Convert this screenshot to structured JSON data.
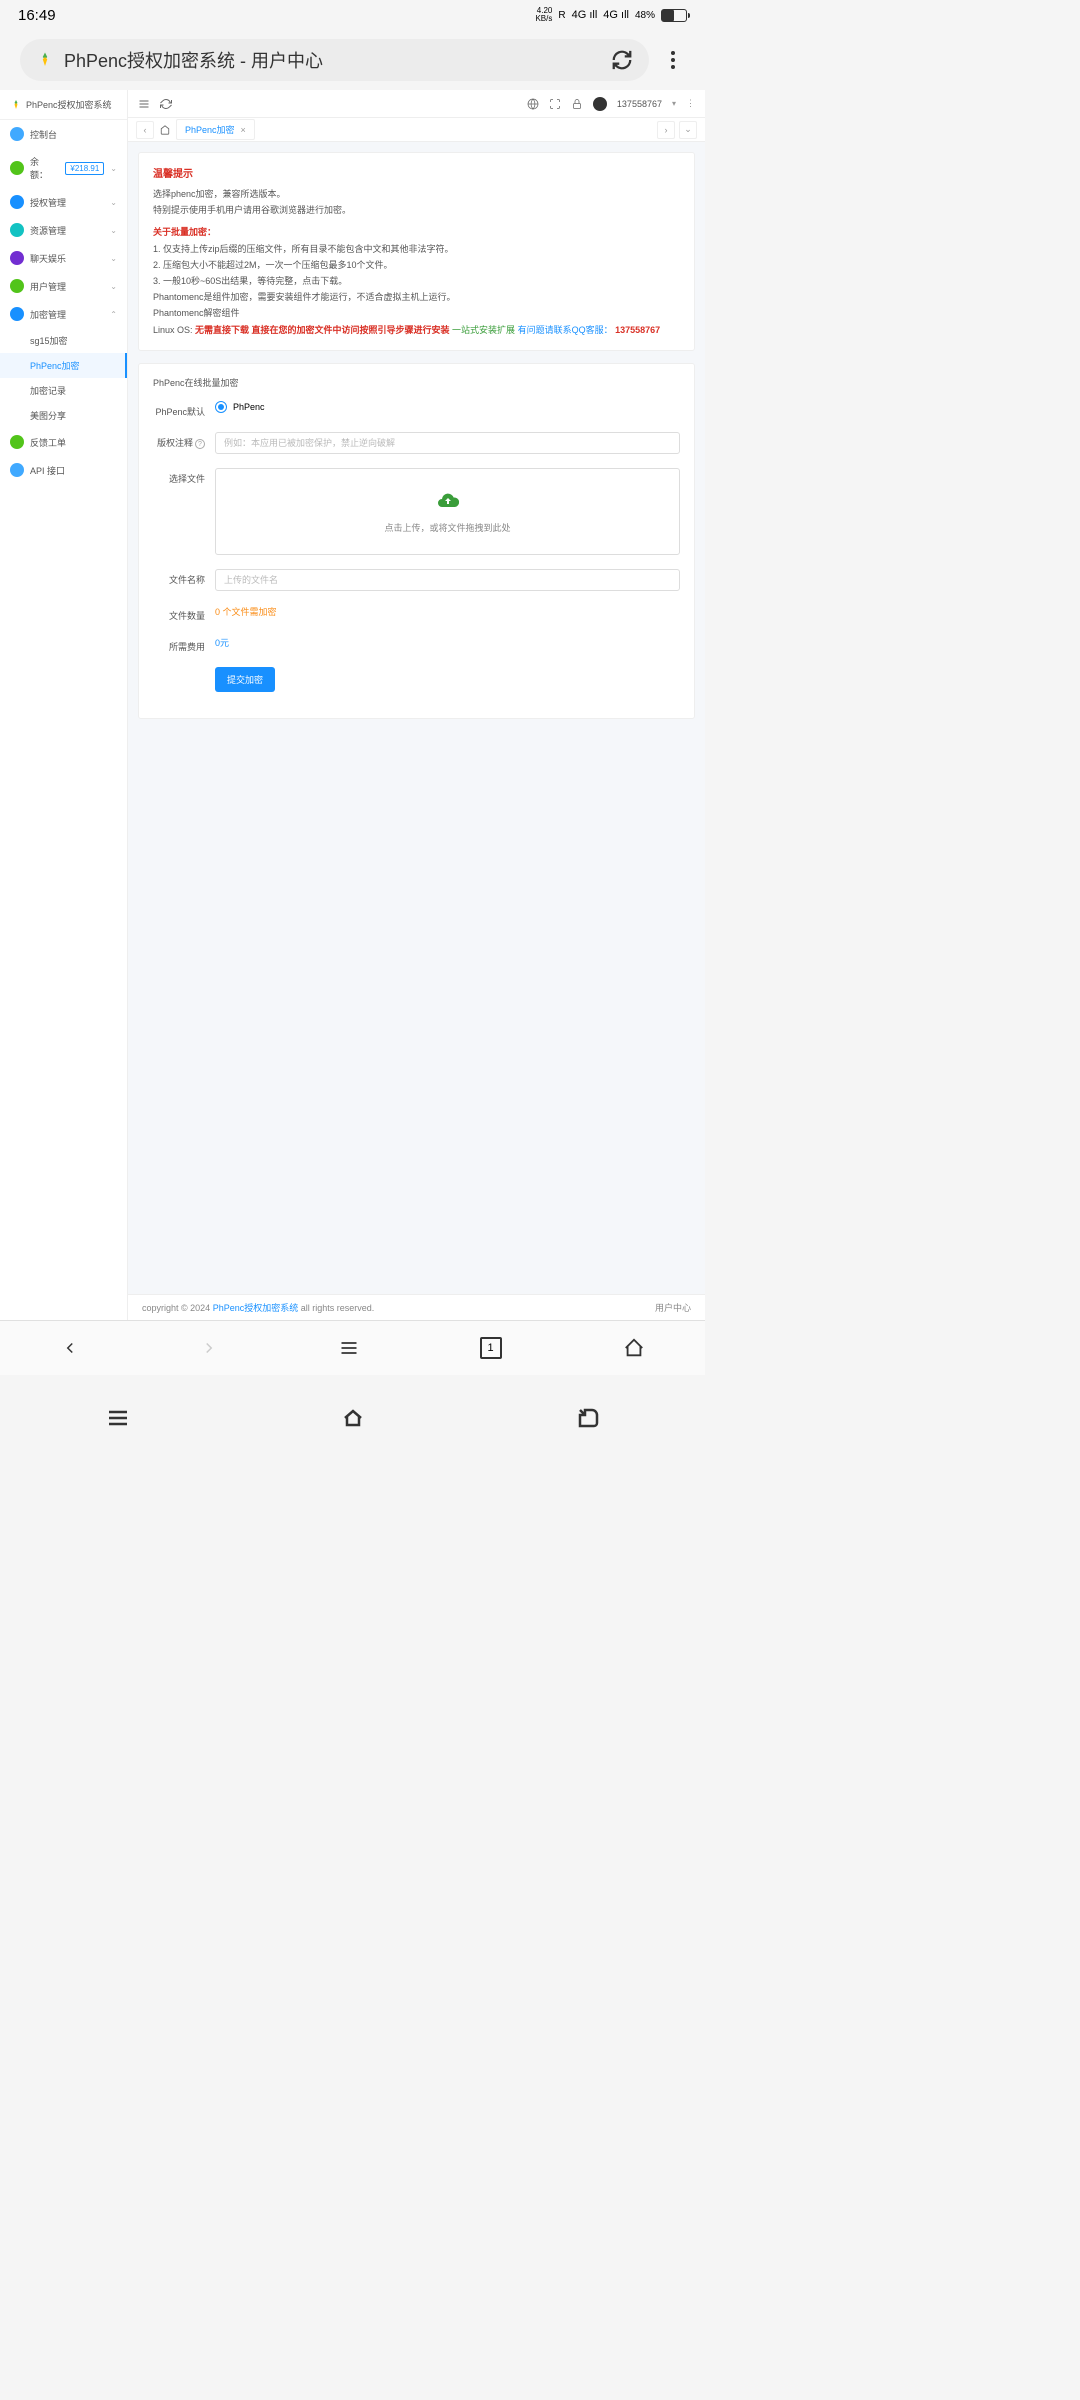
{
  "status": {
    "time": "16:49",
    "speed_top": "4.20",
    "speed_bot": "KB/s",
    "net1": "4G",
    "net2": "4G",
    "r": "R",
    "battery_pct": "48%"
  },
  "browser": {
    "title": "PhPenc授权加密系统 - 用户中心",
    "tab_count": "1"
  },
  "sidebar": {
    "app_name": "PhPenc授权加密系统",
    "items": [
      {
        "label": "控制台",
        "color": "#40a9ff",
        "expandable": false
      },
      {
        "label": "余额：",
        "color": "#52c41a",
        "badge": "¥218.91",
        "expandable": true
      },
      {
        "label": "授权管理",
        "color": "#1890ff",
        "expandable": true
      },
      {
        "label": "资源管理",
        "color": "#13c2c2",
        "expandable": true
      },
      {
        "label": "聊天娱乐",
        "color": "#722ed1",
        "expandable": true
      },
      {
        "label": "用户管理",
        "color": "#52c41a",
        "expandable": true
      },
      {
        "label": "加密管理",
        "color": "#1890ff",
        "expandable": true,
        "open": true,
        "children": [
          {
            "label": "sg15加密",
            "active": false
          },
          {
            "label": "PhPenc加密",
            "active": true
          },
          {
            "label": "加密记录",
            "active": false
          },
          {
            "label": "美图分享",
            "active": false
          }
        ]
      },
      {
        "label": "反馈工单",
        "color": "#52c41a",
        "expandable": false
      },
      {
        "label": "API 接口",
        "color": "#40a9ff",
        "expandable": false
      }
    ]
  },
  "topbar": {
    "username": "137558767"
  },
  "tabs": {
    "current": "PhPenc加密"
  },
  "notice": {
    "title": "温馨提示",
    "l1": "选择phenc加密，兼容所选版本。",
    "l2": "特别提示使用手机用户请用谷歌浏览器进行加密。",
    "batch_title": "关于批量加密：",
    "b1": "1. 仅支持上传zip后缀的压缩文件，所有目录不能包含中文和其他非法字符。",
    "b2": "2. 压缩包大小不能超过2M，一次一个压缩包最多10个文件。",
    "b3": "3. 一般10秒~60S出结果，等待完整，点击下载。",
    "b4": "Phantomenc是组件加密，需要安装组件才能运行，不适合虚拟主机上运行。",
    "b5": "Phantomenc解密组件",
    "linux_prefix": "Linux OS: ",
    "linux_red": "无需直接下载 直接在您的加密文件中访问按照引导步骤进行安装 ",
    "linux_green": "一站式安装扩展 ",
    "linux_blue": "有问题请联系QQ客服：",
    "linux_qq": " 137558767"
  },
  "form": {
    "panel_title": "PhPenc在线批量加密",
    "mode_label": "PhPenc默认",
    "mode_option": "PhPenc",
    "copyright_label": "版权注释",
    "copyright_placeholder": "例如：本应用已被加密保护，禁止逆向破解",
    "file_label": "选择文件",
    "upload_hint": "点击上传，或将文件拖拽到此处",
    "name_label": "文件名称",
    "name_placeholder": "上传的文件名",
    "count_label": "文件数量",
    "count_value": "0 个文件需加密",
    "cost_label": "所需费用",
    "cost_value": "0元",
    "submit": "提交加密"
  },
  "footer": {
    "left_a": "copyright © 2024 ",
    "left_link": "PhPenc授权加密系统",
    "left_b": " all rights reserved.",
    "right": "用户中心"
  }
}
